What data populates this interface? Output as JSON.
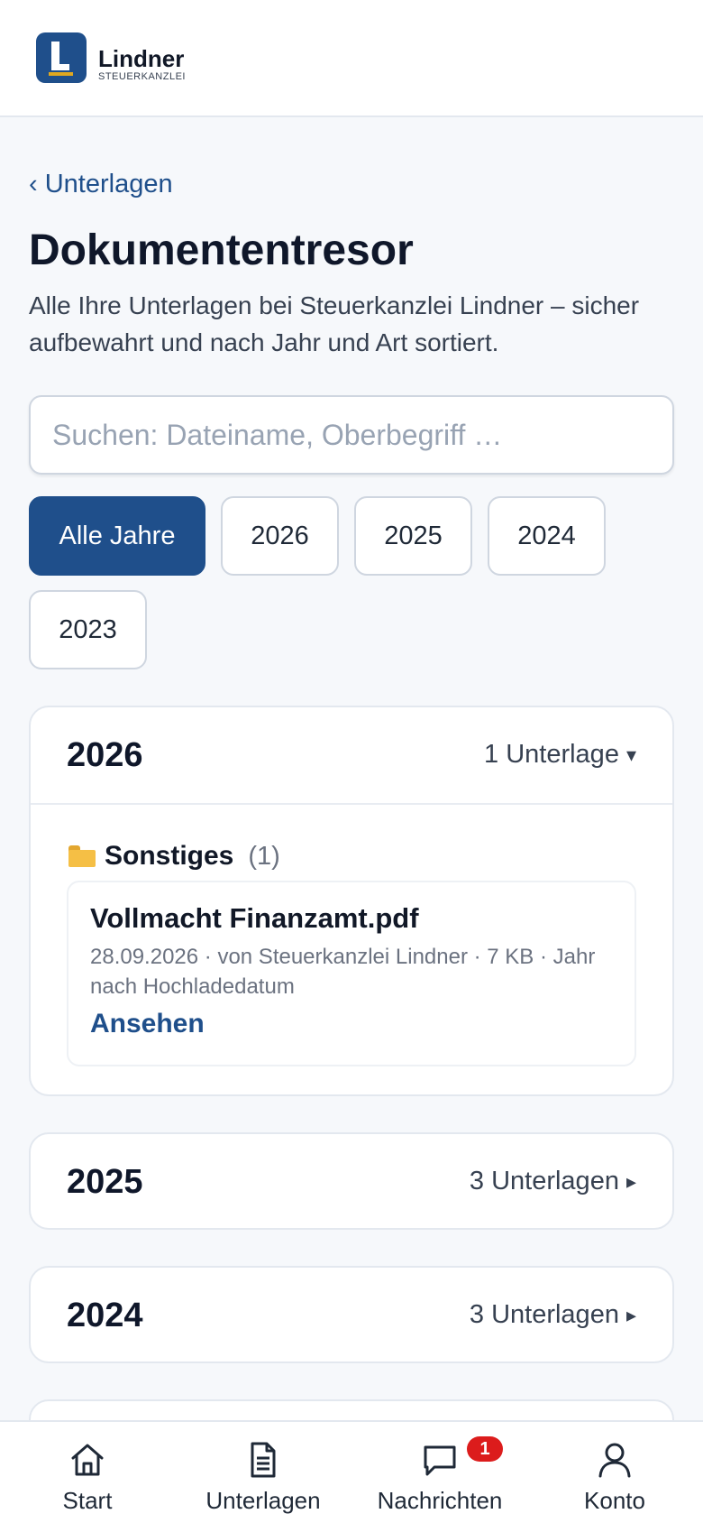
{
  "brand": {
    "name": "Lindner",
    "subtitle": "STEUERKANZLEI"
  },
  "breadcrumb": {
    "back_label": "‹ Unterlagen"
  },
  "page": {
    "title": "Dokumententresor",
    "description": "Alle Ihre Unterlagen bei Steuerkanzlei Lindner – sicher aufbewahrt und nach Jahr und Art sortiert."
  },
  "search": {
    "placeholder": "Suchen: Dateiname, Oberbegriff …",
    "value": ""
  },
  "filters": {
    "selected": "Alle Jahre",
    "chips": [
      "Alle Jahre",
      "2026",
      "2025",
      "2024",
      "2023"
    ]
  },
  "years": [
    {
      "year": "2026",
      "count_label": "1 Unterlage",
      "expanded": true,
      "caret": "▾",
      "categories": [
        {
          "name": "Sonstiges",
          "count": "(1)",
          "icon": "folder-icon",
          "documents": [
            {
              "name": "Vollmacht Finanzamt.pdf",
              "meta": "28.09.2026 · von Steuerkanzlei Lindner · 7 KB · Jahr nach Hochladedatum",
              "action": "Ansehen"
            }
          ]
        }
      ]
    },
    {
      "year": "2025",
      "count_label": "3 Unterlagen",
      "expanded": false,
      "caret": "▸"
    },
    {
      "year": "2024",
      "count_label": "3 Unterlagen",
      "expanded": false,
      "caret": "▸"
    }
  ],
  "nav": {
    "items": [
      {
        "label": "Start",
        "icon": "home-icon"
      },
      {
        "label": "Unterlagen",
        "icon": "document-icon"
      },
      {
        "label": "Nachrichten",
        "icon": "chat-icon",
        "badge": "1"
      },
      {
        "label": "Konto",
        "icon": "user-icon"
      }
    ]
  },
  "colors": {
    "primary": "#1f4f8b",
    "accent": "#e0a820",
    "badge": "#dc1c1c"
  }
}
